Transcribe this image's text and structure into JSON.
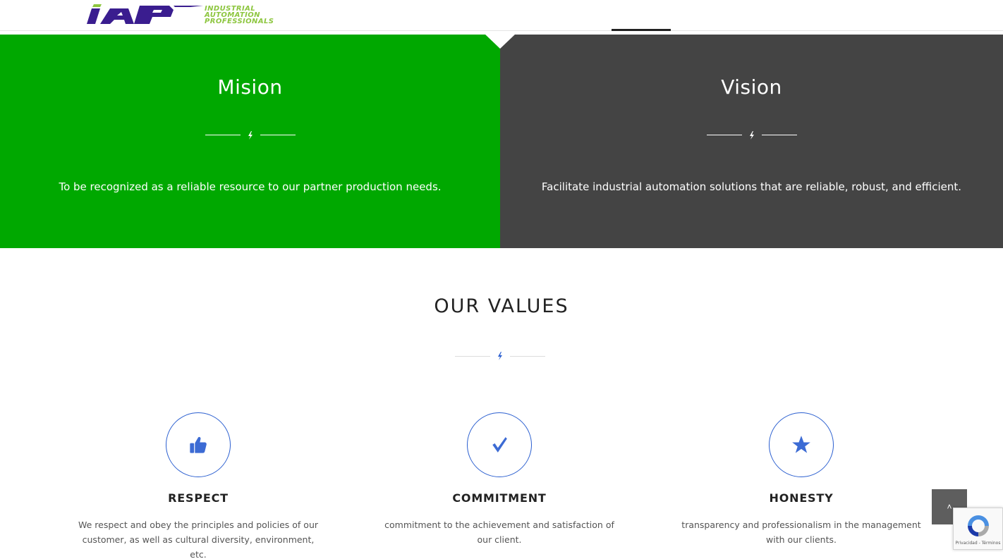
{
  "header": {
    "logo_initials": "IAP",
    "logo_line1": "INDUSTRIAL",
    "logo_line2": "AUTOMATION",
    "logo_line3": "PROFESSIONALS"
  },
  "mission": {
    "title": "Mision",
    "text": "To be recognized as a reliable resource to our partner production needs.",
    "bg_color": "#00a800"
  },
  "vision": {
    "title": "Vision",
    "text": "Facilitate industrial automation solutions that are reliable, robust, and efficient.",
    "bg_color": "#444444"
  },
  "values": {
    "title": "OUR VALUES",
    "accent_color": "#2b5fd0",
    "items": [
      {
        "icon": "thumbs-up-icon",
        "glyph": "👍",
        "title": "RESPECT",
        "text": "We respect and obey the principles and policies of our customer, as well as cultural diversity, environment, etc."
      },
      {
        "icon": "check-icon",
        "glyph": "✓",
        "title": "COMMITMENT",
        "text": "commitment to the achievement and satisfaction of our client."
      },
      {
        "icon": "star-icon",
        "glyph": "★",
        "title": "HONESTY",
        "text": "transparency and professionalism in the management with our clients."
      }
    ]
  },
  "scroll_top": {
    "glyph": "˄"
  },
  "recaptcha": {
    "text": "Privacidad - Términos"
  }
}
